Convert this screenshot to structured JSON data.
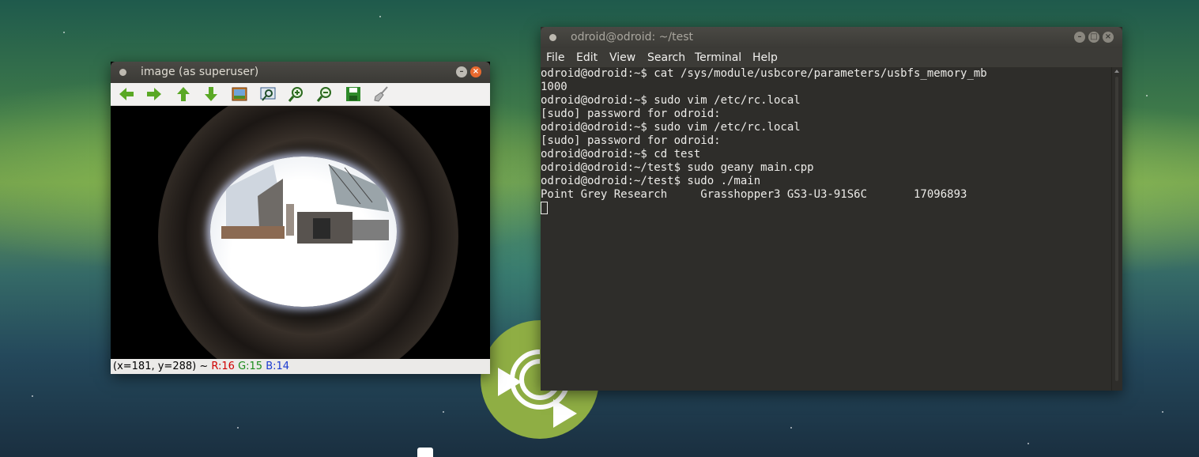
{
  "image_window": {
    "title": "image (as superuser)",
    "toolbar_icons": [
      "arrow-left-icon",
      "arrow-right-icon",
      "arrow-up-icon",
      "arrow-down-icon",
      "image-icon",
      "zoom-window-icon",
      "zoom-in-icon",
      "zoom-out-icon",
      "save-icon",
      "brush-icon"
    ],
    "status": {
      "coords": "(x=181, y=288) ~",
      "r": "R:16",
      "g": "G:15",
      "b": "B:14"
    },
    "colors": {
      "r": "#d00000",
      "g": "#1a8a1a",
      "b": "#1a3ad0"
    }
  },
  "terminal_window": {
    "title": "odroid@odroid: ~/test",
    "menu": [
      "File",
      "Edit",
      "View",
      "Search",
      "Terminal",
      "Help"
    ],
    "lines": [
      "odroid@odroid:~$ cat /sys/module/usbcore/parameters/usbfs_memory_mb",
      "1000",
      "odroid@odroid:~$ sudo vim /etc/rc.local",
      "[sudo] password for odroid:",
      "odroid@odroid:~$ sudo vim /etc/rc.local",
      "[sudo] password for odroid:",
      "odroid@odroid:~$ cd test",
      "odroid@odroid:~/test$ sudo geany main.cpp",
      "odroid@odroid:~/test$ sudo ./main",
      "Point Grey Research     Grasshopper3 GS3-U3-91S6C       17096893"
    ]
  },
  "desktop": {
    "logo_icon": "linux-mint-logo-icon",
    "logo_color": "#8fae44"
  }
}
